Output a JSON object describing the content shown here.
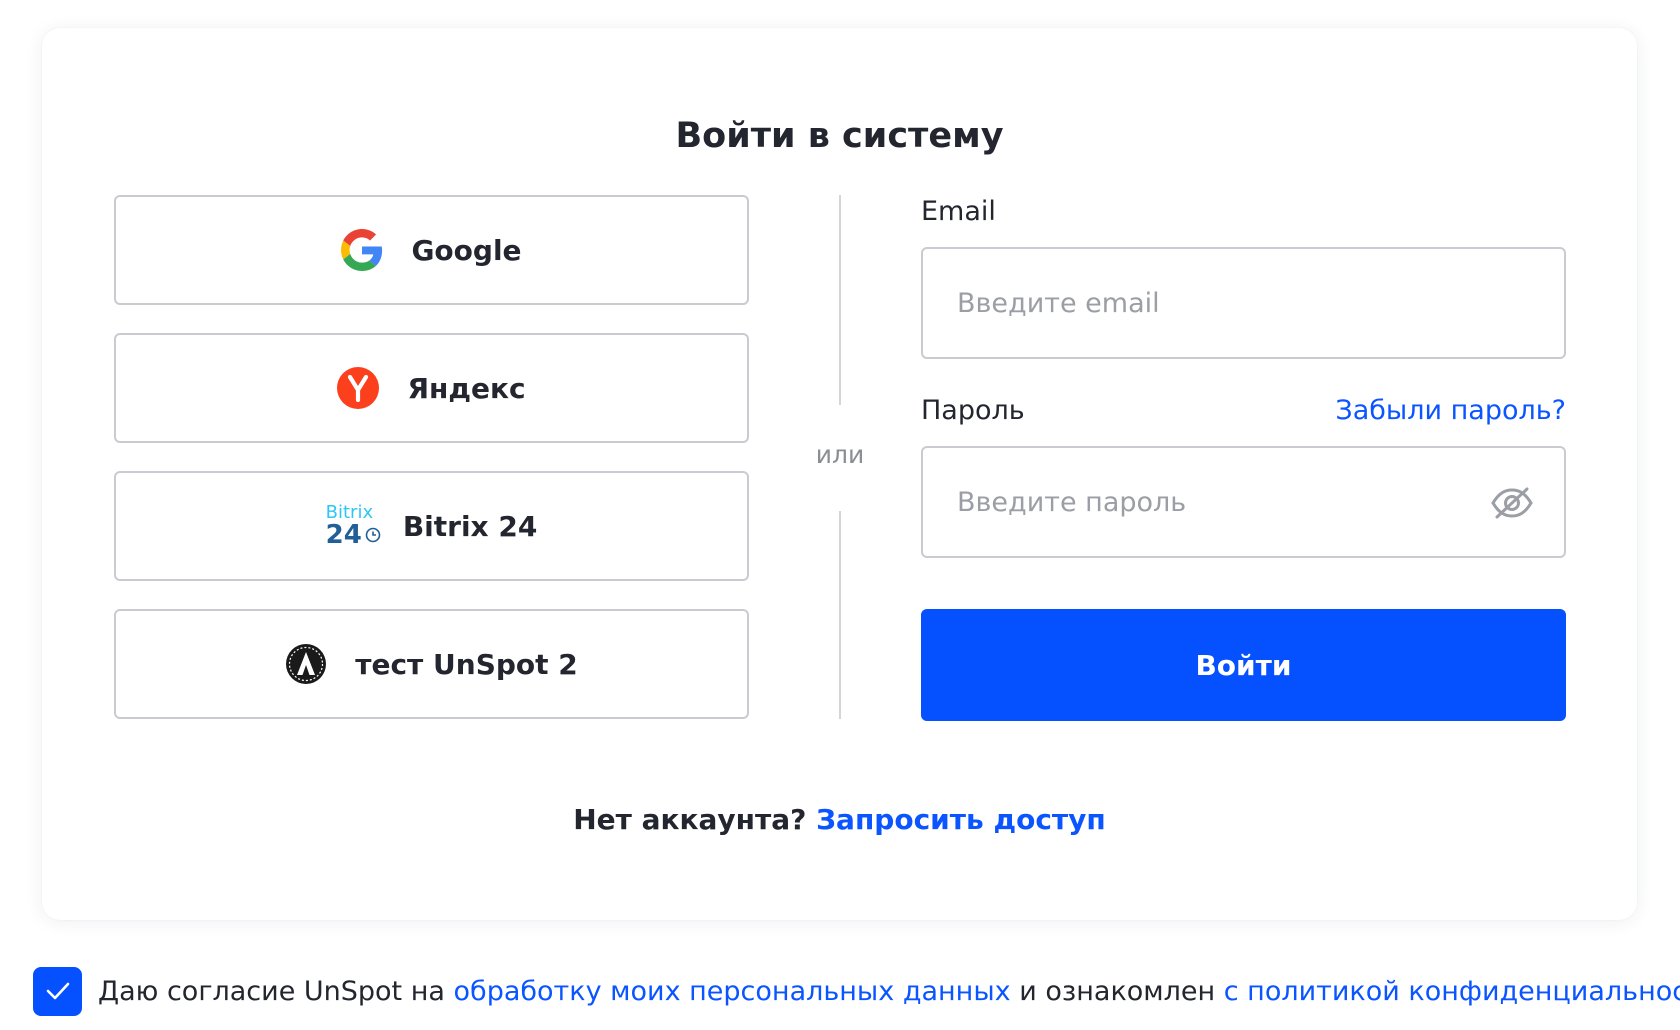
{
  "login": {
    "title": "Войти в систему",
    "sso_buttons": [
      {
        "label": "Google",
        "icon": "google-icon"
      },
      {
        "label": "Яндекс",
        "icon": "yandex-icon"
      },
      {
        "label": "Bitrix 24",
        "icon": "bitrix24-icon",
        "logo_text_top": "Bitrix",
        "logo_text_bottom": "24"
      },
      {
        "label": "тест UnSpot 2",
        "icon": "unspot-logo-icon"
      }
    ],
    "divider_text": "или",
    "email": {
      "label": "Email",
      "placeholder": "Введите email",
      "value": ""
    },
    "password": {
      "label": "Пароль",
      "placeholder": "Введите пароль",
      "value": "",
      "forgot_link": "Забыли пароль?",
      "toggle_icon": "eye-off-icon"
    },
    "submit_label": "Войти",
    "no_account_text": "Нет аккаунта?",
    "request_access_link": "Запросить доступ"
  },
  "consent": {
    "checked": true,
    "text_before": "Даю согласие UnSpot на",
    "link_personal_data": "обработку моих персональных данных",
    "text_middle": "и ознакомлен",
    "link_privacy_policy": "с политикой конфиденциальности"
  },
  "colors": {
    "accent": "#0551FF",
    "link": "#0A55FF",
    "text": "#23262F",
    "border": "#C9CBD0",
    "placeholder": "#9B9EA5"
  }
}
